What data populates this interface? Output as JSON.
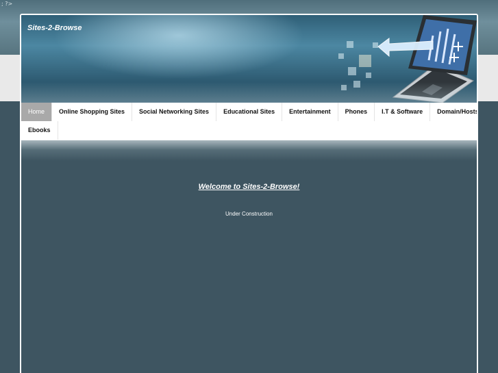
{
  "stray_text": "; ?>",
  "site": {
    "title": "Sites-2-Browse"
  },
  "nav": {
    "items": [
      {
        "label": "Home",
        "active": true
      },
      {
        "label": "Online Shopping Sites"
      },
      {
        "label": "Social Networking Sites"
      },
      {
        "label": "Educational Sites"
      },
      {
        "label": "Entertainment"
      },
      {
        "label": "Phones"
      },
      {
        "label": "I.T & Software"
      },
      {
        "label": "Domain/Hosts"
      },
      {
        "label": "Ebooks"
      }
    ]
  },
  "main": {
    "welcome_link": "Welcome to Sites-2-Browse!",
    "status_text": "Under Construction"
  },
  "colors": {
    "page_bg": "#3e5561",
    "header_blue": "#4c87a2",
    "nav_active_bg": "#a9a9a9",
    "nav_bg": "#ffffff"
  },
  "icons": [
    "laptop-illustration",
    "arrow-icon"
  ]
}
